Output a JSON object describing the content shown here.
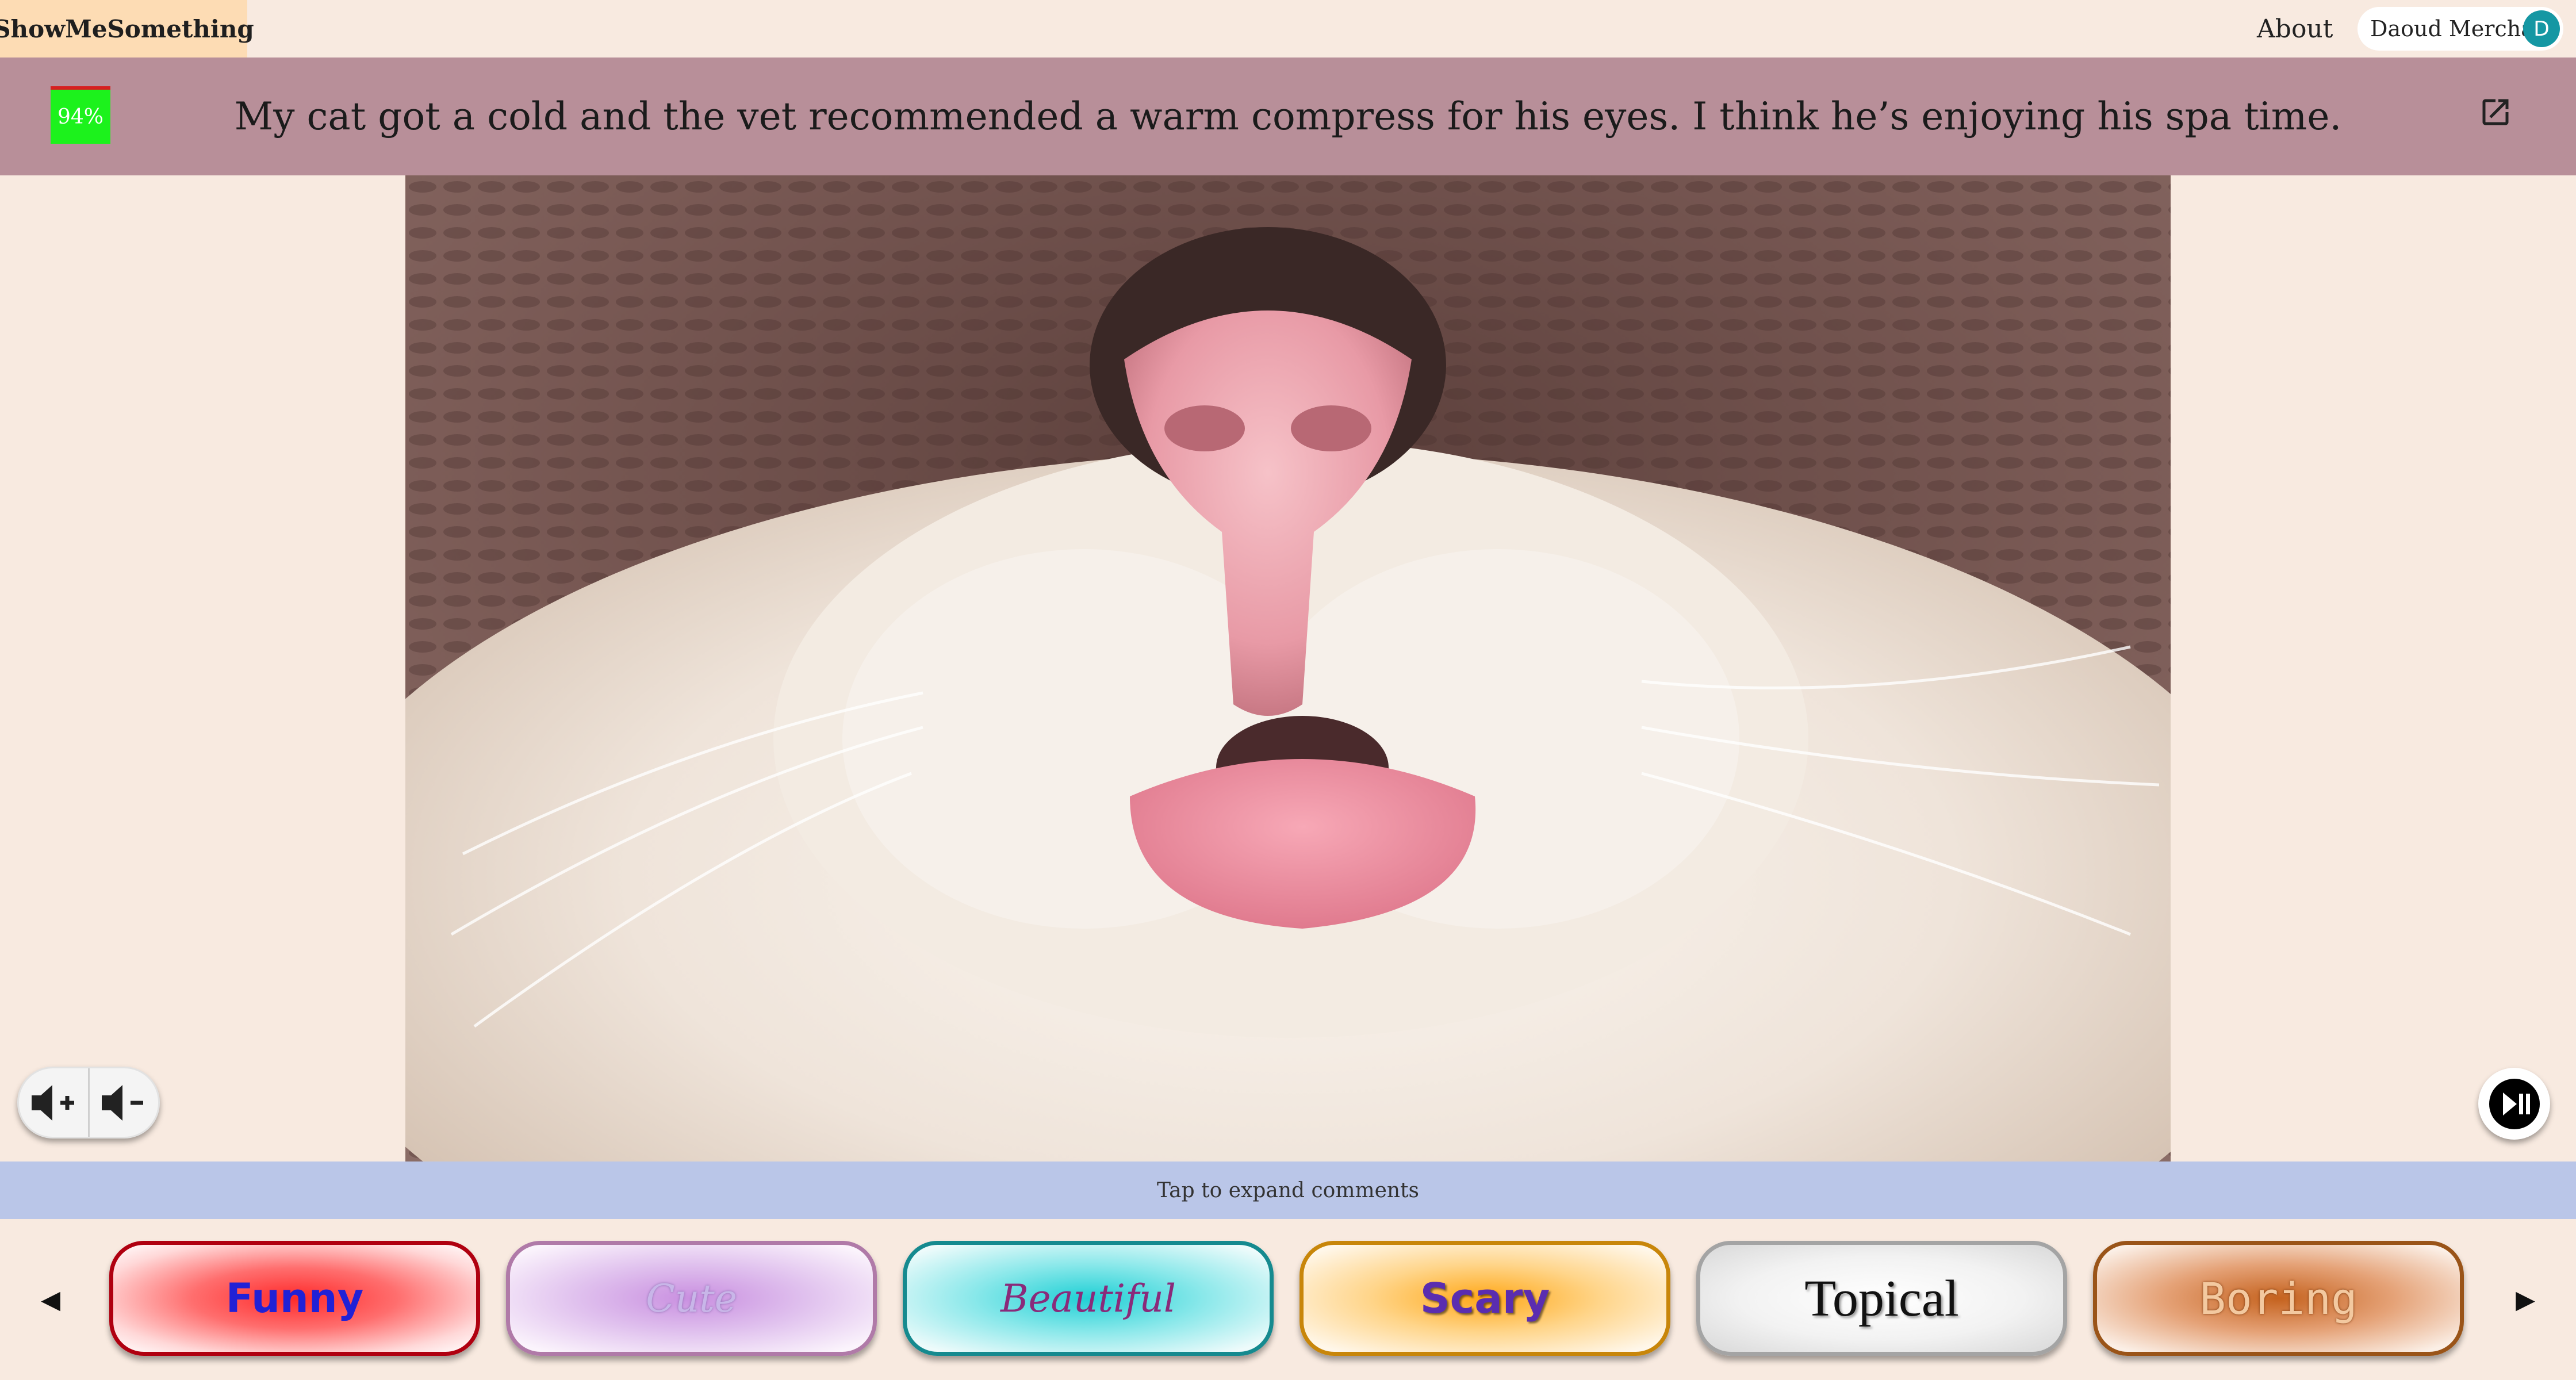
{
  "header": {
    "brand": "ShowMeSomething",
    "about_label": "About",
    "user_name": "Daoud Merchant",
    "avatar_initial": "D"
  },
  "post": {
    "score": "94%",
    "title": "My cat got a cold and the vet recommended a warm compress for his eyes. I think he’s enjoying his spa time.",
    "open_external_icon": "open-external-icon"
  },
  "media": {
    "content": "close-up of cat nose and tongue",
    "volume_up_icon": "volume-up-icon",
    "volume_down_icon": "volume-down-icon",
    "play_pause_icon": "play-pause-icon"
  },
  "comments": {
    "label": "Tap to expand comments"
  },
  "reactions": {
    "prev_icon": "◀",
    "next_icon": "▶",
    "items": [
      {
        "label": "Funny"
      },
      {
        "label": "Cute"
      },
      {
        "label": "Beautiful"
      },
      {
        "label": "Scary"
      },
      {
        "label": "Topical"
      },
      {
        "label": "Boring"
      }
    ]
  },
  "colors": {
    "background": "#f8eae0",
    "brand_bg": "#fddcb4",
    "title_band": "#b88f99",
    "comments_band": "#bac6e8",
    "avatar": "#1597a3",
    "score_bg": "#1cf21c"
  }
}
